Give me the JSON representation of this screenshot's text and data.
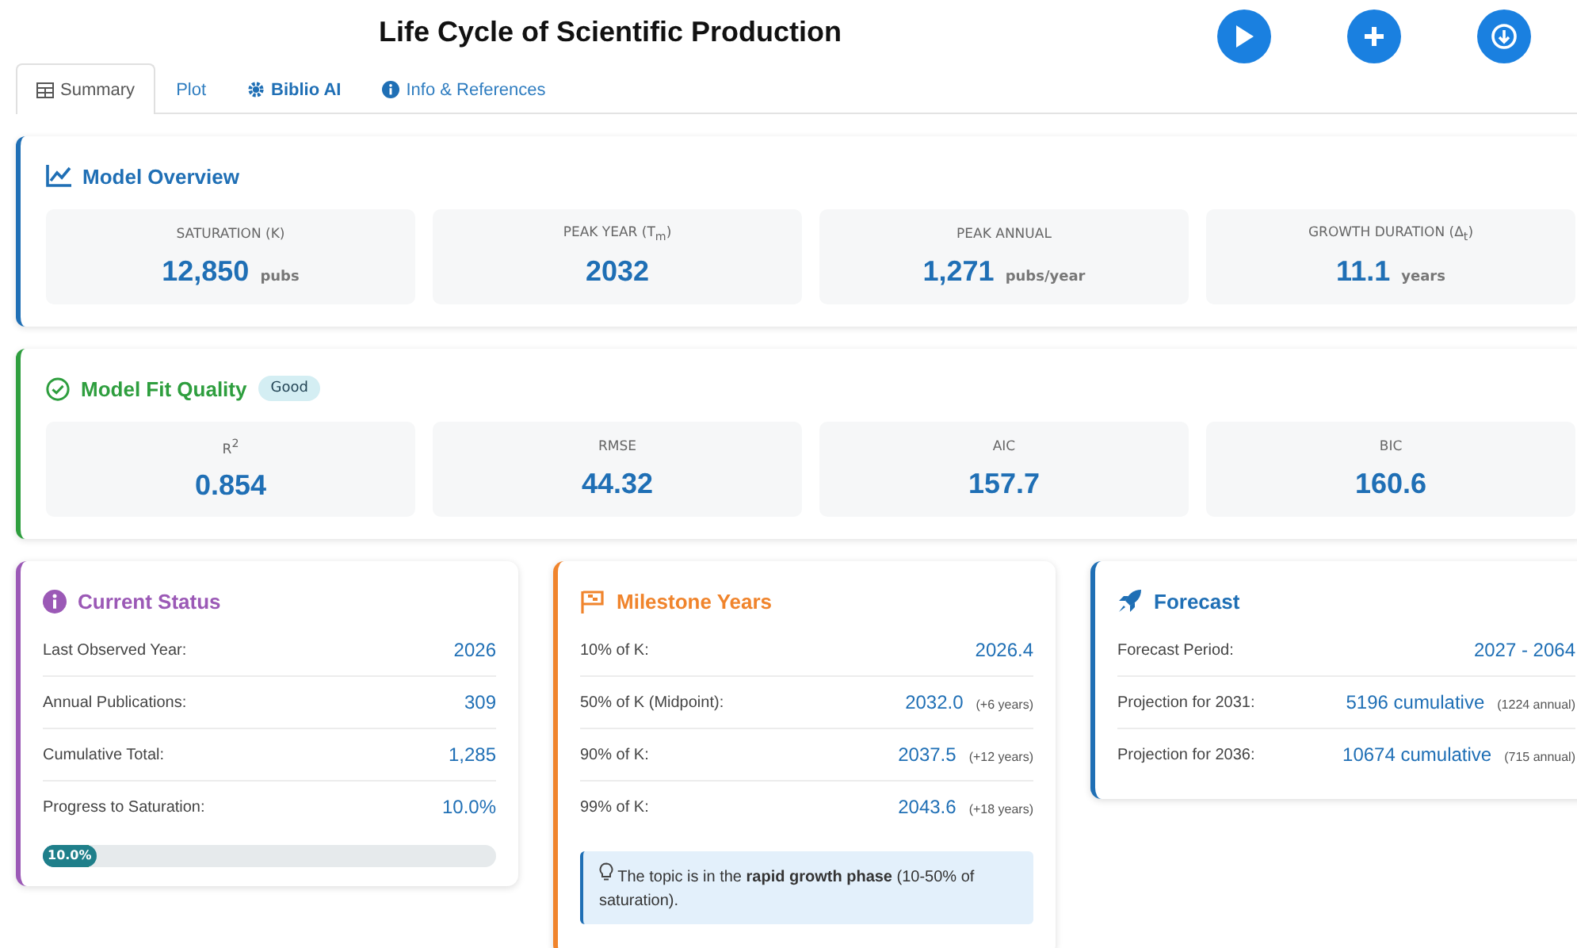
{
  "title": "Life Cycle of Scientific Production",
  "tabs": [
    {
      "label": "Summary",
      "selected": true
    },
    {
      "label": "Plot",
      "selected": false
    },
    {
      "label": "Biblio AI",
      "selected": false
    },
    {
      "label": "Info & References",
      "selected": false
    }
  ],
  "overview": {
    "title": "Model Overview",
    "stats": [
      {
        "label": "SATURATION (K)",
        "value": "12,850",
        "unit": "pubs"
      },
      {
        "label": "PEAK YEAR (T$_{m}$)",
        "value": "2032"
      },
      {
        "label": "PEAK ANNUAL",
        "value": "1,271",
        "unit": "pubs/year"
      },
      {
        "label": "GROWTH DURATION (Δ$_{t}$)",
        "value": "11.1",
        "unit": "years"
      }
    ]
  },
  "fit": {
    "title": "Model Fit Quality",
    "badge": "Good",
    "stats": [
      {
        "label": "R$^{2}$",
        "value": "0.854"
      },
      {
        "label": "RMSE",
        "value": "44.32"
      },
      {
        "label": "AIC",
        "value": "157.7"
      },
      {
        "label": "BIC",
        "value": "160.6"
      }
    ]
  },
  "current_status": {
    "title": "Current Status",
    "rows": [
      {
        "label": "Last Observed Year:",
        "value": "2026"
      },
      {
        "label": "Annual Publications:",
        "value": "309"
      },
      {
        "label": "Cumulative Total:",
        "value": "1,285"
      },
      {
        "label": "Progress to Saturation:",
        "value": "10.0%"
      }
    ],
    "progress": {
      "level": 0.1,
      "label": "10.0%"
    }
  },
  "milestones": {
    "title": "Milestone Years",
    "rows": [
      {
        "label": "10% of K:",
        "value": "2026.4"
      },
      {
        "label": "50% of K (Midpoint):",
        "value": "2032.0",
        "note": "(+6 years)"
      },
      {
        "label": "90% of K:",
        "value": "2037.5",
        "note": "(+12 years)"
      },
      {
        "label": "99% of K:",
        "value": "2043.6",
        "note": "(+18 years)"
      }
    ],
    "tip": "The topic is in the **rapid growth phase** (10-50% of saturation)."
  },
  "forecast": {
    "title": "Forecast",
    "rows": [
      {
        "label": "Forecast Period:",
        "value": "2027 - 2064"
      },
      {
        "label": "Projection for 2031:",
        "value": "5196 cumulative",
        "note": "(1224 annual)"
      },
      {
        "label": "Projection for 2036:",
        "value": "10674 cumulative",
        "note": "(715 annual)"
      }
    ]
  }
}
